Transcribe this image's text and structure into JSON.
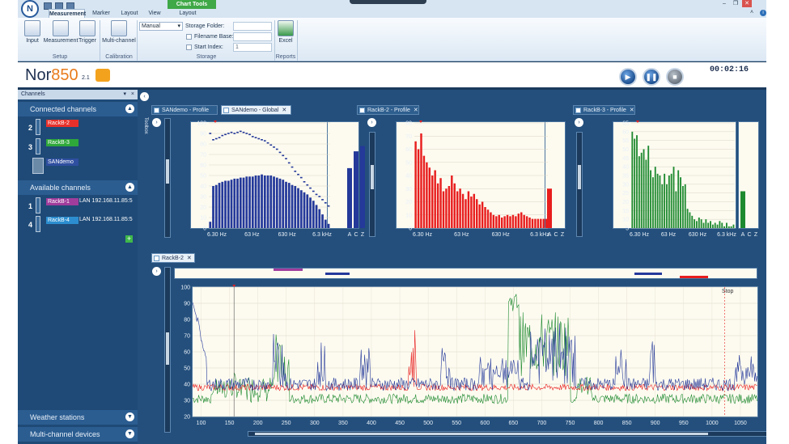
{
  "app": {
    "title": "Nor850",
    "version": "2.1"
  },
  "ribbon": {
    "tabs": [
      "Measurement",
      "Marker",
      "Layout",
      "View",
      "Layout"
    ],
    "context_tab": "Chart Tools",
    "buttons": {
      "input": "Input",
      "measurement": "Measurement",
      "trigger": "Trigger",
      "multichannel": "Multi-channel",
      "excel": "Excel"
    },
    "groups": {
      "setup": "Setup",
      "calibration": "Calibration",
      "storage": "Storage",
      "reports": "Reports"
    },
    "storage": {
      "mode": "Manual",
      "folder_label": "Storage Folder:",
      "filename_label": "Filename Base:",
      "start_index_label": "Start Index:",
      "start_index_value": "1"
    }
  },
  "playback": {
    "elapsed": "00:02:16"
  },
  "sidebar": {
    "title": "Channels",
    "connected_header": "Connected channels",
    "available_header": "Available channels",
    "weather_header": "Weather stations",
    "multichannel_header": "Multi-channel devices",
    "connected": [
      {
        "num": "2",
        "name": "RackB-2",
        "color": "#e8302a"
      },
      {
        "num": "3",
        "name": "RackB-3",
        "color": "#2fa83a"
      },
      {
        "num": "",
        "name": "SANdemo",
        "color": "#2f4fa0"
      }
    ],
    "available": [
      {
        "num": "1",
        "name": "RackB-1",
        "color": "#a03c9c",
        "lan": "LAN 192.168.11.85:5"
      },
      {
        "num": "4",
        "name": "RackB-4",
        "color": "#2c8ed0",
        "lan": "LAN 192.168.11.85:5"
      }
    ]
  },
  "toolbox_label": "Toolbox",
  "panels": {
    "p1": {
      "tabs": [
        "SANdemo - Profile",
        "SANdemo - Global"
      ]
    },
    "p2": {
      "tabs": [
        "RackB-2 - Profile"
      ]
    },
    "p3": {
      "tabs": [
        "RackB-3 - Profile"
      ]
    },
    "bottom": {
      "tab": "RackB-2",
      "stop_label": "Stop"
    }
  },
  "colors": {
    "blue": "#24399a",
    "red": "#e81e1e",
    "green": "#1e8a30",
    "purple": "#a03c9c"
  },
  "chart_data": [
    {
      "type": "bar",
      "name": "SANdemo - Global",
      "y_ticks": [
        "100",
        "90",
        "80",
        "70",
        "60",
        "50",
        "40",
        "30",
        "20",
        "10",
        "0"
      ],
      "x_ticks": [
        "6.30 Hz",
        "63 Hz",
        "630 Hz",
        "6.3 kHz"
      ],
      "ylim": [
        0,
        100
      ],
      "values": [
        6,
        40,
        41,
        43,
        44,
        45,
        45,
        46,
        47,
        47,
        48,
        48,
        49,
        49,
        49,
        50,
        50,
        51,
        50,
        50,
        50,
        49,
        48,
        47,
        46,
        44,
        43,
        41,
        40,
        38,
        36,
        34,
        32,
        29,
        26,
        22,
        18,
        13,
        8,
        4
      ],
      "max_values": [
        90,
        84,
        85,
        86,
        88,
        89,
        90,
        91,
        90,
        91,
        92,
        91,
        90,
        89,
        87,
        86,
        85,
        84,
        83,
        81,
        79,
        77,
        75,
        72,
        69,
        66,
        62,
        58,
        54,
        51,
        48,
        44,
        41,
        38,
        35,
        32,
        30,
        27,
        24,
        21
      ],
      "abc": {
        "labels": [
          "A",
          "C",
          "Z"
        ],
        "values": [
          57,
          73,
          78
        ]
      }
    },
    {
      "type": "bar",
      "name": "RackB-2 - Profile",
      "y_ticks": [
        "80",
        "70",
        "60",
        "50",
        "40",
        "30",
        "20",
        "10",
        "0"
      ],
      "x_ticks": [
        "6.30 Hz",
        "63 Hz",
        "630 Hz",
        "6.3 kHz"
      ],
      "ylim": [
        0,
        80
      ],
      "values": [
        66,
        60,
        72,
        55,
        50,
        46,
        40,
        44,
        34,
        38,
        28,
        30,
        32,
        40,
        34,
        28,
        30,
        26,
        22,
        28,
        24,
        26,
        22,
        18,
        20,
        16,
        14,
        12,
        10,
        9,
        10,
        8,
        9,
        10,
        9,
        10,
        9,
        11,
        12,
        10,
        9,
        8,
        7,
        7,
        7,
        7,
        7,
        7
      ],
      "abc": {
        "labels": [
          "A",
          "C",
          "Z"
        ],
        "values": [
          30
        ]
      }
    },
    {
      "type": "bar",
      "name": "RackB-3 - Profile",
      "y_ticks": [
        "65",
        "60",
        "55",
        "50",
        "45",
        "40",
        "35",
        "30",
        "25",
        "20",
        "15",
        "10",
        "5"
      ],
      "x_ticks": [
        "6.30 Hz",
        "63 Hz",
        "630 Hz",
        "6.3 kHz"
      ],
      "ylim": [
        5,
        65
      ],
      "values": [
        60,
        56,
        58,
        46,
        48,
        50,
        44,
        52,
        38,
        34,
        40,
        36,
        35,
        30,
        36,
        30,
        35,
        36,
        40,
        26,
        38,
        34,
        29,
        30,
        16,
        14,
        12,
        10,
        9,
        11,
        10,
        8,
        10,
        8,
        9,
        7,
        8,
        7,
        9,
        8,
        6,
        8,
        6,
        6,
        7
      ],
      "abc": {
        "labels": [
          "A",
          "C",
          "Z"
        ],
        "values": [
          26
        ]
      }
    },
    {
      "type": "line",
      "name": "RackB-2",
      "x_ticks": [
        "100",
        "150",
        "200",
        "250",
        "300",
        "350",
        "400",
        "450",
        "500",
        "550",
        "600",
        "650",
        "700",
        "750",
        "800",
        "850",
        "900",
        "950",
        "1000",
        "1050"
      ],
      "y_ticks": [
        "100",
        "90",
        "80",
        "70",
        "60",
        "50",
        "40",
        "30",
        "20"
      ],
      "xlim": [
        85,
        1080
      ],
      "ylim": [
        20,
        100
      ],
      "stop_x": 1022,
      "cursor_x": 158
    }
  ]
}
